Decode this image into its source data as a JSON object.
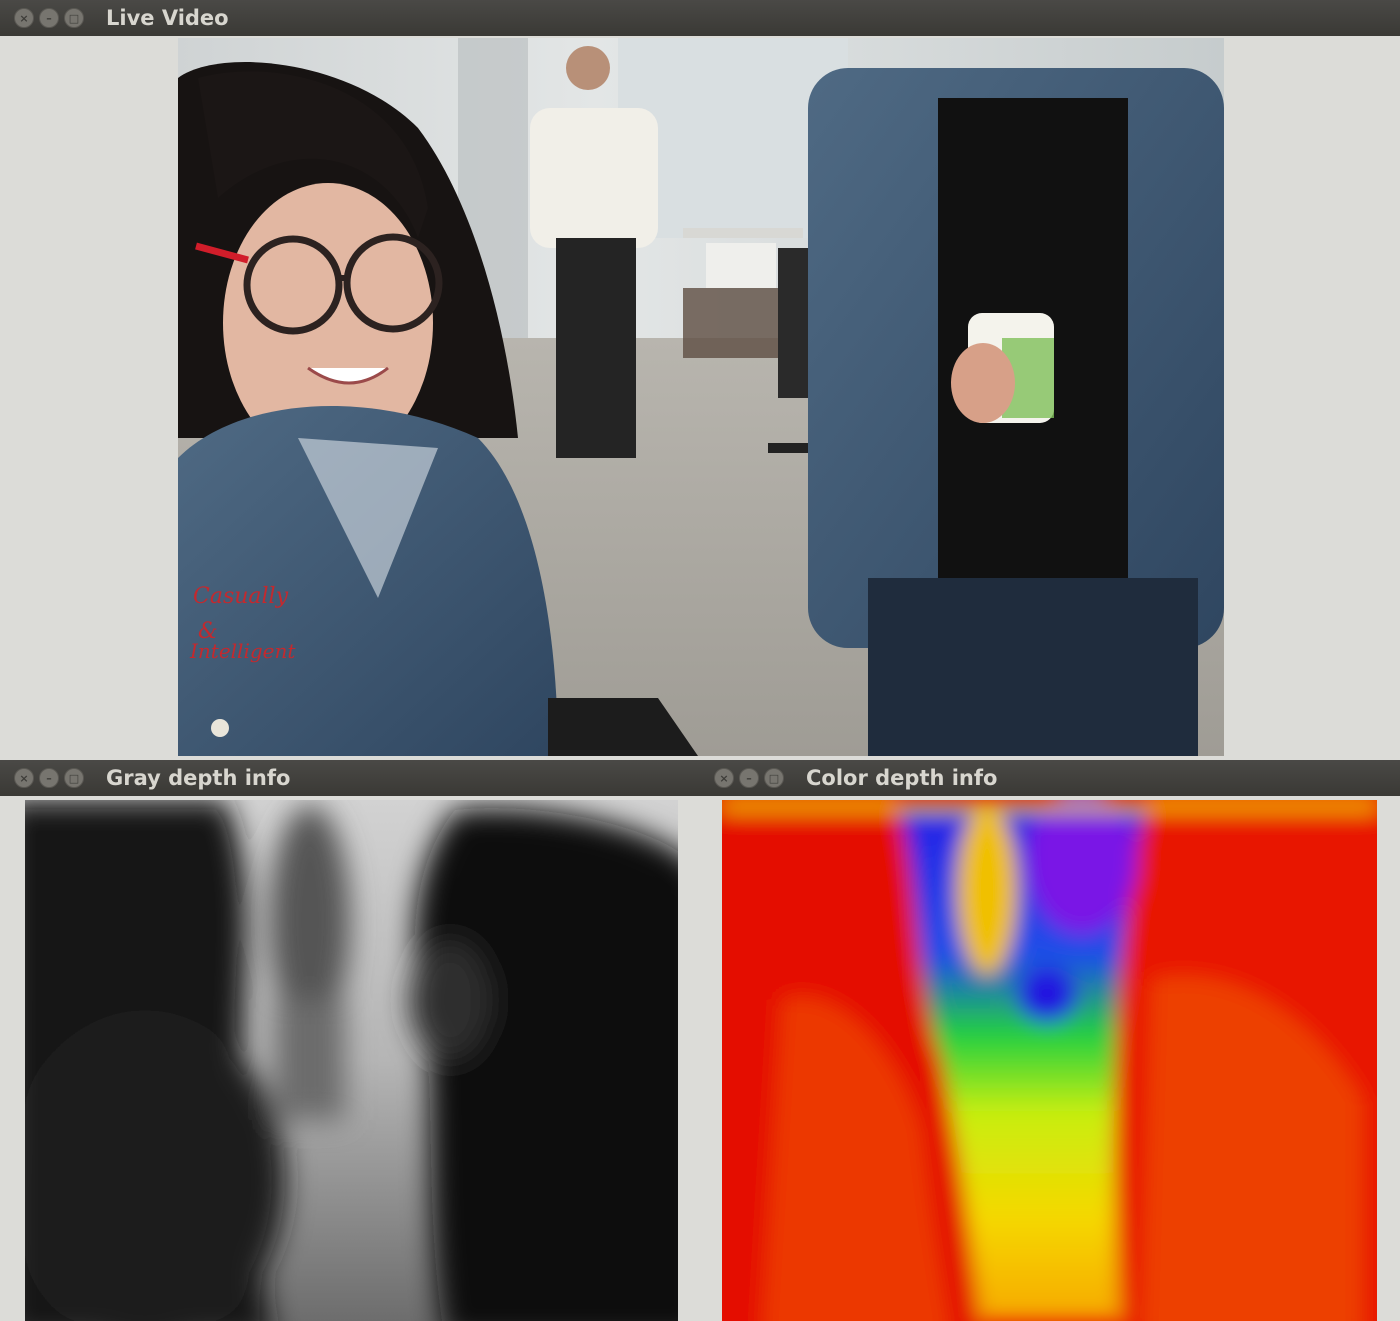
{
  "windows": {
    "live_video": {
      "title": "Live Video"
    },
    "gray_depth": {
      "title": "Gray depth info"
    },
    "color_depth": {
      "title": "Color depth info"
    }
  },
  "titlebar_buttons": {
    "close_glyph": "×",
    "minimize_glyph": "–",
    "maximize_glyph": "□"
  },
  "colors": {
    "titlebar": "#3e3d39",
    "window_bg": "#dcdcd8",
    "depth_near": "#e40a00",
    "depth_mid": "#f5e600",
    "depth_far": "#2016e0"
  }
}
